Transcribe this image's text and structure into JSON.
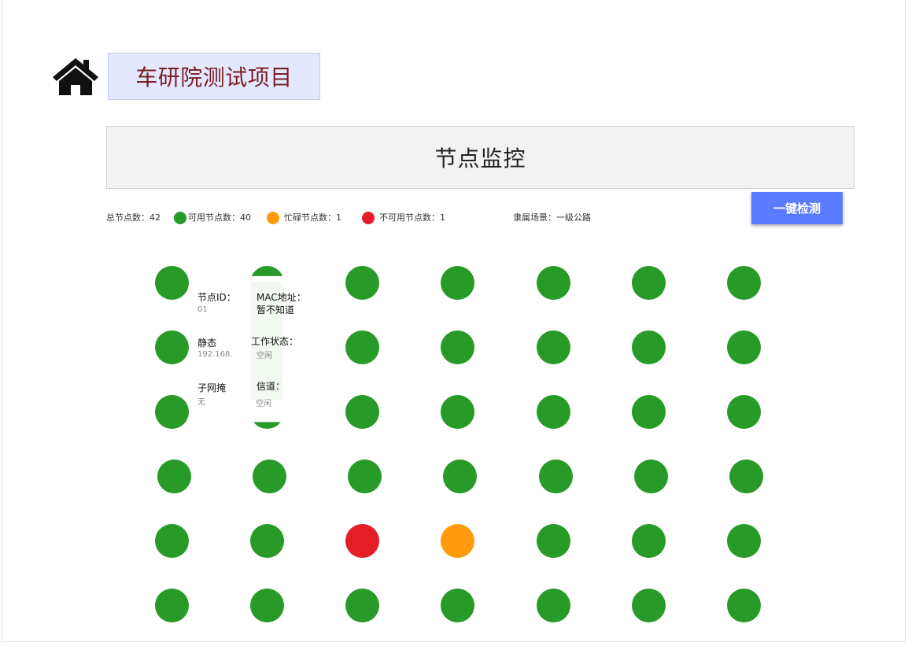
{
  "project": {
    "title": "车研院测试项目"
  },
  "panel": {
    "title": "节点监控"
  },
  "stats": {
    "total": "总节点数：42",
    "available": "可用节点数：40",
    "busy": "忙碌节点数：1",
    "unavailable": "不可用节点数：1",
    "scene": "隶属场景：一级公路"
  },
  "colors": {
    "available": "#279a27",
    "busy": "#ff9b0d",
    "unavailable": "#e31e27",
    "button": "#5b7bff",
    "title_bg": "#e4e8ff"
  },
  "actions": {
    "check_all": "一键检测"
  },
  "node_popup": {
    "id_label": "节点ID：",
    "id_value": "01",
    "mac_label": "MAC地址：",
    "mac_value": "暂不知道",
    "mode_label": "静态",
    "ip_value": "192.168.",
    "work_label": "工作状态：",
    "work_value": "空闲",
    "mask_label": "子网掩",
    "mask_value": "无",
    "channel_label": "信道：",
    "channel_value": "空闲"
  },
  "grid": {
    "rows": [
      [
        "available",
        "available",
        "available",
        "available",
        "available",
        "available",
        "available"
      ],
      [
        "available",
        "available",
        "available",
        "available",
        "available",
        "available",
        "available"
      ],
      [
        "available",
        "available",
        "available",
        "available",
        "available",
        "available",
        "available"
      ],
      [
        "available",
        "available",
        "available",
        "available",
        "available",
        "available",
        "available"
      ],
      [
        "available",
        "available",
        "unavailable",
        "busy",
        "available",
        "available",
        "available"
      ],
      [
        "available",
        "available",
        "available",
        "available",
        "available",
        "available",
        "available"
      ]
    ]
  },
  "icons": {
    "home": "home-icon"
  }
}
